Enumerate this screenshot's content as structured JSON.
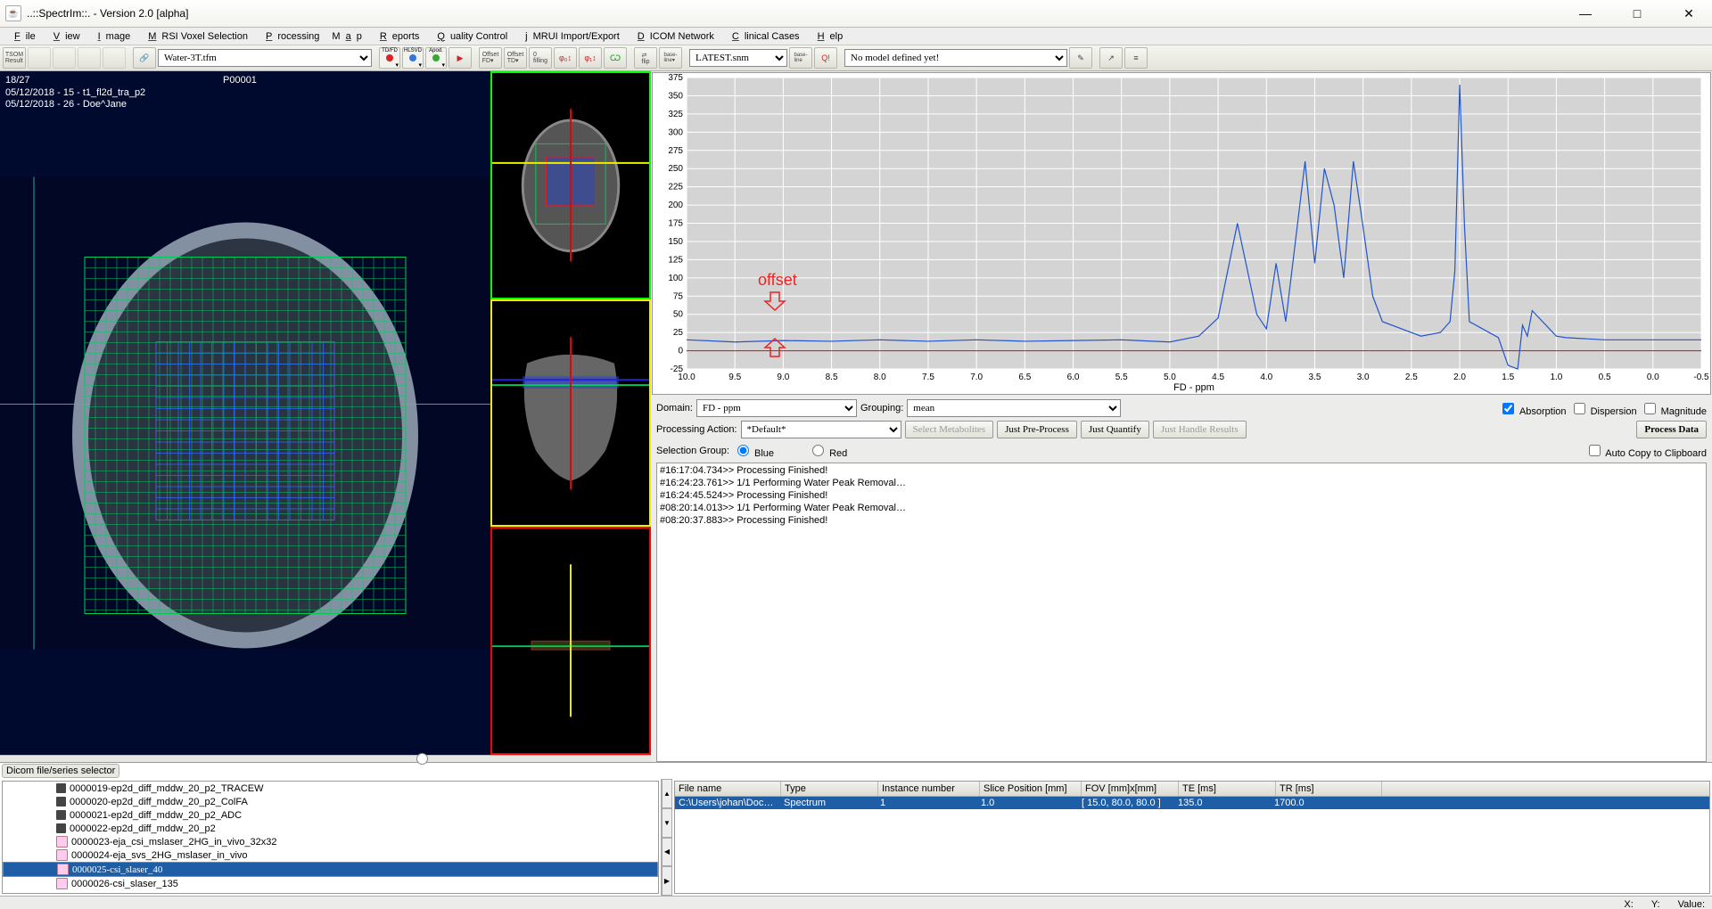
{
  "window": {
    "title": "..::SpectrIm::.   -   Version 2.0 [alpha]"
  },
  "menu": [
    "File",
    "View",
    "Image",
    "MRSI Voxel Selection",
    "Processing",
    "Map",
    "Reports",
    "Quality Control",
    "jMRUI Import/Export",
    "DICOM Network",
    "Clinical Cases",
    "Help"
  ],
  "toolbar": {
    "preset_select": "Water-3T.tfm",
    "snm_select": "LATEST.snm",
    "model_select": "No model defined yet!"
  },
  "viewer": {
    "slice": "18/27",
    "patient": "P00001",
    "line1": "05/12/2018 - 15 - t1_fl2d_tra_p2",
    "line2": "05/12/2018 - 26 - Doe^Jane"
  },
  "chart_data": {
    "type": "line",
    "title": "",
    "xlabel": "FD - ppm",
    "ylabel": "",
    "xlim": [
      10.0,
      -0.5
    ],
    "ylim": [
      -25,
      375
    ],
    "xticks": [
      10.0,
      9.5,
      9.0,
      8.5,
      8.0,
      7.5,
      7.0,
      6.5,
      6.0,
      5.5,
      5.0,
      4.5,
      4.0,
      3.5,
      3.0,
      2.5,
      2.0,
      1.5,
      1.0,
      0.5,
      0.0,
      -0.5
    ],
    "yticks": [
      -25,
      0,
      25,
      50,
      75,
      100,
      125,
      150,
      175,
      200,
      225,
      250,
      275,
      300,
      325,
      350,
      375
    ],
    "annotation": "offset",
    "baseline": 0,
    "series": [
      {
        "name": "spectrum",
        "x": [
          10.0,
          9.5,
          9.0,
          8.5,
          8.0,
          7.5,
          7.0,
          6.5,
          6.0,
          5.5,
          5.0,
          4.7,
          4.5,
          4.3,
          4.1,
          4.0,
          3.9,
          3.8,
          3.6,
          3.5,
          3.4,
          3.3,
          3.2,
          3.1,
          3.0,
          2.9,
          2.8,
          2.6,
          2.4,
          2.2,
          2.1,
          2.05,
          2.0,
          1.95,
          1.9,
          1.6,
          1.5,
          1.4,
          1.35,
          1.3,
          1.25,
          1.0,
          0.9,
          0.5,
          0.0,
          -0.5
        ],
        "y": [
          15,
          12,
          14,
          13,
          15,
          13,
          15,
          13,
          14,
          15,
          12,
          20,
          45,
          175,
          50,
          30,
          120,
          40,
          260,
          120,
          250,
          200,
          100,
          260,
          170,
          75,
          40,
          30,
          20,
          25,
          40,
          110,
          365,
          170,
          40,
          18,
          -20,
          -25,
          35,
          20,
          55,
          20,
          18,
          15,
          15,
          15
        ]
      }
    ]
  },
  "controls": {
    "domain_label": "Domain:",
    "domain_value": "FD - ppm",
    "grouping_label": "Grouping:",
    "grouping_value": "mean",
    "absorption": "Absorption",
    "dispersion": "Dispersion",
    "magnitude": "Magnitude",
    "proc_action_label": "Processing Action:",
    "proc_action_value": "*Default*",
    "select_metab": "Select Metabolites",
    "just_preprocess": "Just Pre-Process",
    "just_quantify": "Just Quantify",
    "just_handle": "Just Handle Results",
    "process_data": "Process Data",
    "sel_group_label": "Selection Group:",
    "blue": "Blue",
    "red": "Red",
    "autocopy": "Auto Copy to Clipboard"
  },
  "log": [
    "#16:17:04.734>> Processing Finished!",
    "#16:24:23.761>> 1/1 Performing Water Peak Removal…",
    "#16:24:45.524>> Processing Finished!",
    "#08:20:14.013>> 1/1 Performing Water Peak Removal…",
    "#08:20:37.883>> Processing Finished!"
  ],
  "selector_label": "Dicom file/series selector",
  "tree": [
    {
      "label": "0000019-ep2d_diff_mddw_20_p2_TRACEW",
      "sel": false,
      "ico": "d"
    },
    {
      "label": "0000020-ep2d_diff_mddw_20_p2_ColFA",
      "sel": false,
      "ico": "d"
    },
    {
      "label": "0000021-ep2d_diff_mddw_20_p2_ADC",
      "sel": false,
      "ico": "d"
    },
    {
      "label": "0000022-ep2d_diff_mddw_20_p2",
      "sel": false,
      "ico": "d"
    },
    {
      "label": "0000023-eja_csi_mslaser_2HG_in_vivo_32x32",
      "sel": false,
      "ico": "p"
    },
    {
      "label": "0000024-eja_svs_2HG_mslaser_in_vivo",
      "sel": false,
      "ico": "p"
    },
    {
      "label": "0000025-csi_slaser_40",
      "sel": true,
      "ico": "p"
    },
    {
      "label": "0000026-csi_slaser_135",
      "sel": false,
      "ico": "p"
    }
  ],
  "table": {
    "headers": [
      "File name",
      "Type",
      "Instance number",
      "Slice Position [mm]",
      "FOV [mm]x[mm]",
      "TE [ms]",
      "TR [ms]"
    ],
    "widths": [
      110,
      100,
      105,
      105,
      100,
      100,
      110
    ],
    "row": [
      "C:\\Users\\johan\\Doc…",
      "Spectrum",
      "1",
      "1.0",
      "[ 15.0, 80.0, 80.0 ]",
      "135.0",
      "1700.0"
    ]
  },
  "status": {
    "x": "X:",
    "y": "Y:",
    "v": "Value:"
  }
}
